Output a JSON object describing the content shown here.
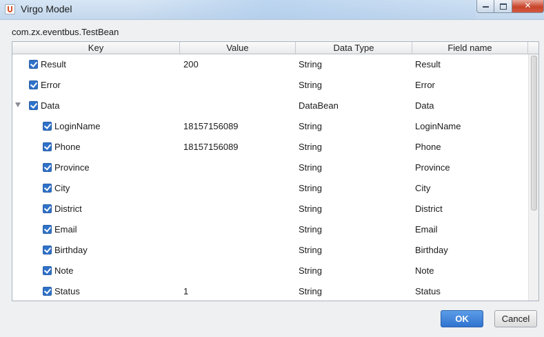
{
  "window": {
    "title": "Virgo Model"
  },
  "class_name": "com.zx.eventbus.TestBean",
  "table": {
    "columns": [
      "Key",
      "Value",
      "Data Type",
      "Field name"
    ],
    "rows": [
      {
        "key": "Result",
        "value": "200",
        "type": "String",
        "field": "Result",
        "checked": true,
        "level": 0
      },
      {
        "key": "Error",
        "value": "",
        "type": "String",
        "field": "Error",
        "checked": true,
        "level": 0
      },
      {
        "key": "Data",
        "value": "",
        "type": "DataBean",
        "field": "Data",
        "checked": true,
        "level": 0,
        "expanded": true
      },
      {
        "key": "LoginName",
        "value": "18157156089",
        "type": "String",
        "field": "LoginName",
        "checked": true,
        "level": 1
      },
      {
        "key": "Phone",
        "value": "18157156089",
        "type": "String",
        "field": "Phone",
        "checked": true,
        "level": 1
      },
      {
        "key": "Province",
        "value": "",
        "type": "String",
        "field": "Province",
        "checked": true,
        "level": 1
      },
      {
        "key": "City",
        "value": "",
        "type": "String",
        "field": "City",
        "checked": true,
        "level": 1
      },
      {
        "key": "District",
        "value": "",
        "type": "String",
        "field": "District",
        "checked": true,
        "level": 1
      },
      {
        "key": "Email",
        "value": "",
        "type": "String",
        "field": "Email",
        "checked": true,
        "level": 1
      },
      {
        "key": "Birthday",
        "value": "",
        "type": "String",
        "field": "Birthday",
        "checked": true,
        "level": 1
      },
      {
        "key": "Note",
        "value": "",
        "type": "String",
        "field": "Note",
        "checked": true,
        "level": 1
      },
      {
        "key": "Status",
        "value": "1",
        "type": "String",
        "field": "Status",
        "checked": true,
        "level": 1
      }
    ]
  },
  "buttons": {
    "ok": "OK",
    "cancel": "Cancel"
  },
  "colors": {
    "accent": "#2f73cf",
    "checkbox": "#2f72c9"
  }
}
